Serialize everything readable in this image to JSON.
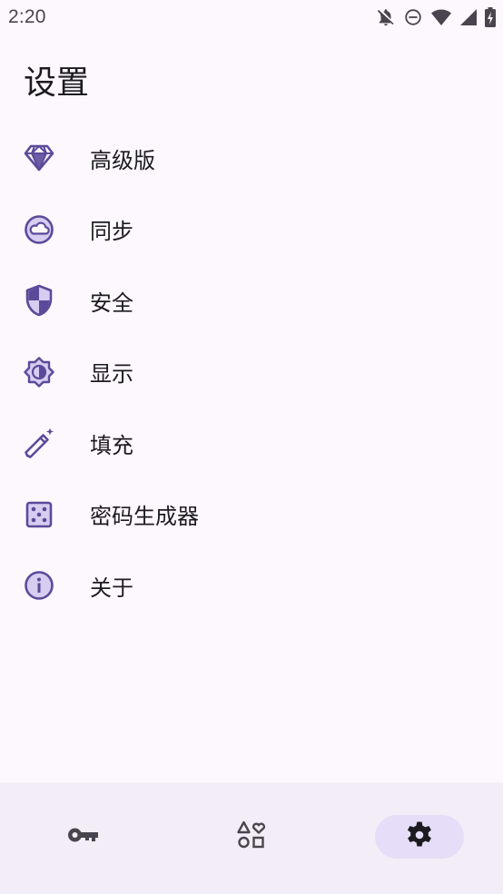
{
  "status_bar": {
    "time": "2:20",
    "icons": [
      "notifications-off-icon",
      "do-not-disturb-icon",
      "wifi-icon",
      "cellular-signal-icon",
      "battery-charging-icon"
    ]
  },
  "page": {
    "title": "设置"
  },
  "settings": {
    "items": [
      {
        "label": "高级版",
        "icon": "diamond-icon"
      },
      {
        "label": "同步",
        "icon": "cloud-sync-icon"
      },
      {
        "label": "安全",
        "icon": "shield-icon"
      },
      {
        "label": "显示",
        "icon": "brightness-icon"
      },
      {
        "label": "填充",
        "icon": "magic-wand-icon"
      },
      {
        "label": "密码生成器",
        "icon": "dice-icon"
      },
      {
        "label": "关于",
        "icon": "info-icon"
      }
    ]
  },
  "bottom_nav": {
    "items": [
      {
        "icon": "key-icon",
        "active": false
      },
      {
        "icon": "shapes-icon",
        "active": false
      },
      {
        "icon": "gear-icon",
        "active": true
      }
    ]
  },
  "colors": {
    "background": "#FDF8FD",
    "accent": "#6750A4",
    "icon": "#5B4A9A",
    "nav_background": "#F2EDF6",
    "nav_active_pill": "#E6DEF8"
  }
}
